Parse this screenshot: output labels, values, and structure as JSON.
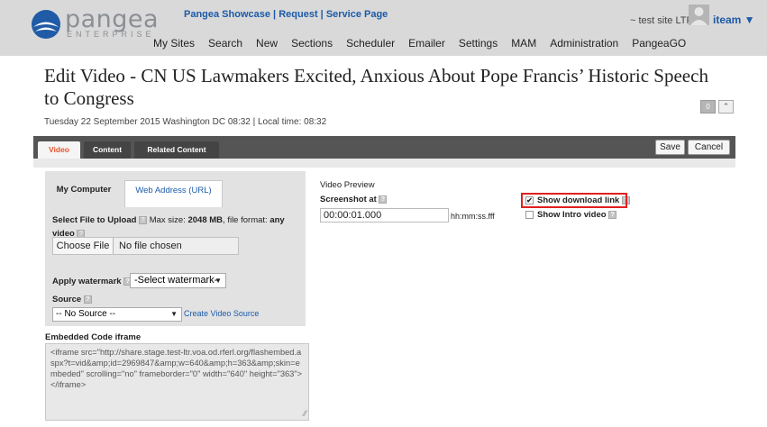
{
  "header": {
    "logo_text": "pangea",
    "logo_sub": "ENTERPRISE",
    "top_links": [
      "Pangea Showcase",
      "Request",
      "Service Page"
    ],
    "nav": [
      "My Sites",
      "Search",
      "New",
      "Sections",
      "Scheduler",
      "Emailer",
      "Settings",
      "MAM",
      "Administration",
      "PangeaGO"
    ],
    "site_info": "~ test site LTR",
    "user_name": "iteam ▼"
  },
  "page": {
    "title": "Edit Video - CN US Lawmakers Excited, Anxious About Pope Francis’ Historic Speech to Congress",
    "date_line": "Tuesday 22 September 2015 Washington DC 08:32 | Local time: 08:32",
    "counter": "0",
    "collapse_glyph": "⌃"
  },
  "tabs": [
    "Video",
    "Content",
    "Related Content"
  ],
  "toolbar": {
    "save": "Save",
    "cancel": "Cancel"
  },
  "upload": {
    "tab_mycomputer": "My Computer",
    "tab_weburl": "Web Address (URL)",
    "select_label": "Select File to Upload",
    "max_size_prefix": "Max size:",
    "max_size": "2048 MB",
    "file_format_prefix": ", file format:",
    "file_format": "any",
    "file_format_suffix": "video",
    "choose_file": "Choose File",
    "no_file": "No file chosen",
    "watermark_label": "Apply watermark",
    "watermark_value": "-Select watermark-",
    "source_label": "Source",
    "source_value": "-- No Source --",
    "create_source": "Create Video Source"
  },
  "embed": {
    "label": "Embedded Code iframe",
    "code": "<iframe src=\"http://share.stage.test-ltr.voa.od.rferl.org/flashembed.aspx?t=vid&amp;id=2969847&amp;w=640&amp;h=363&amp;skin=embeded\" scrolling=\"no\" frameborder=\"0\" width=\"640\" height=\"363\"></iframe>"
  },
  "preview": {
    "label": "Video Preview",
    "screenshot_label": "Screenshot at",
    "screenshot_value": "00:00:01.000",
    "screenshot_format": "hh:mm:ss.fff",
    "show_download": "Show download link",
    "show_download_checked": true,
    "show_intro": "Show Intro video",
    "show_intro_checked": false
  }
}
